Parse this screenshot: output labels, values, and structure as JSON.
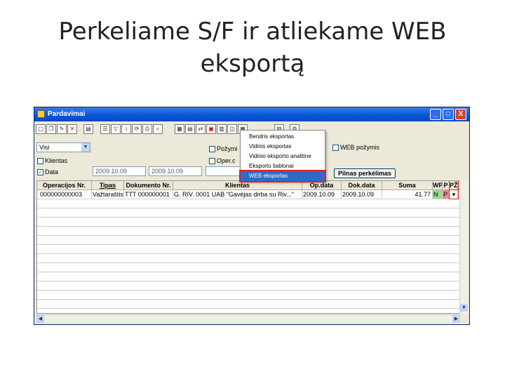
{
  "slide": {
    "title": "Perkeliame S/F ir atliekame WEB eksportą"
  },
  "window": {
    "title": "Pardavimai",
    "min": "_",
    "max": "□",
    "close": "X"
  },
  "toolbar": {
    "buttons": [
      "new-doc-icon",
      "copy-icon",
      "wizard-icon",
      "delete-icon",
      "paste-icon",
      "list-icon",
      "filter-icon",
      "sort-icon",
      "refresh-icon",
      "print-icon",
      "find-icon",
      "grid-icon",
      "table-icon",
      "link-icon",
      "export-icon",
      "report-icon",
      "misc-icon",
      "calc-icon",
      "view-icon",
      "settings-icon"
    ]
  },
  "filters": {
    "period_value": "Visi",
    "klientas_label": "Klientas",
    "klientas_checked": false,
    "data_label": "Data",
    "data_checked": true,
    "date_from": "2009.10.09",
    "date_to": "2009.10.09",
    "pozymis_label": "Požymi",
    "operacija_label": "Oper.c",
    "web_pozymis_label": "WEB požymis",
    "pilnas_button": "Pilnas perkėlimas"
  },
  "menu": {
    "items": [
      "Bendris eksportas",
      "Vidinis eksportas",
      "Vidinio eksporto analitine",
      "Eksporto šablonai",
      "WEB eksportas"
    ],
    "selected_index": 4
  },
  "grid": {
    "columns": [
      "Operacijos Nr.",
      "Tipas",
      "Dokumento Nr.",
      "Klientas",
      "Op.data",
      "Dok.data",
      "Suma",
      "WP",
      "P",
      "PŽ"
    ],
    "rows": [
      [
        "000000000003",
        "Važtaraštis",
        "TTT 000000001",
        "G. RIV. 0001   UAB \"Gavėjas dirba su Riv...\"",
        "2009.10.09",
        "2009.10.09",
        "41.77",
        "N",
        "P",
        ""
      ]
    ]
  },
  "colors": {
    "titlebar": "#0a57d8",
    "menu_highlight": "#316ac5",
    "highlight_border": "#e02020"
  }
}
